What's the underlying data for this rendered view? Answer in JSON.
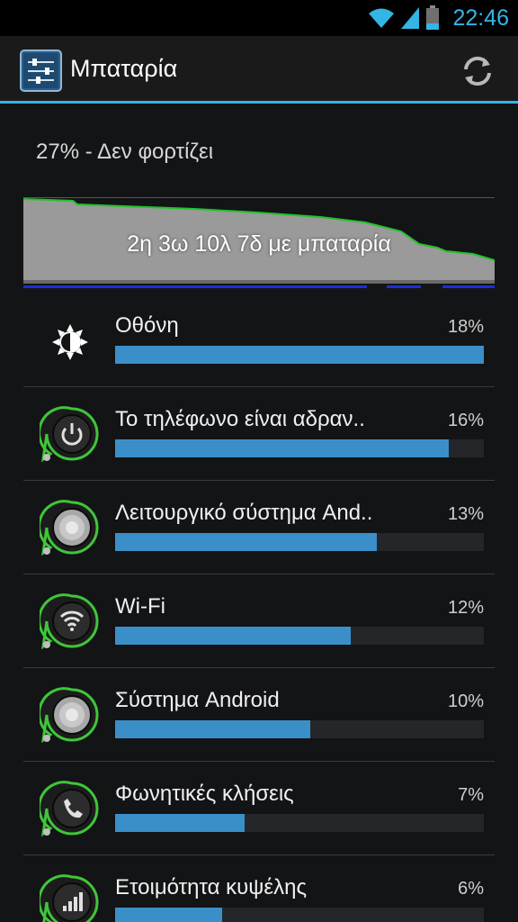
{
  "status_bar": {
    "time": "22:46"
  },
  "action_bar": {
    "title": "Μπαταρία"
  },
  "battery_status": "27% - Δεν φορτίζει",
  "graph_label": "2η 3ω 10λ 7δ με μπαταρία",
  "usage": [
    {
      "label": "Οθόνη",
      "percent": "18%",
      "fraction": 1.0,
      "icon": "brightness-icon"
    },
    {
      "label": "Το τηλέφωνο είναι αδραν..",
      "percent": "16%",
      "fraction": 0.905,
      "icon": "power-icon"
    },
    {
      "label": "Λειτουργικό σύστημα And..",
      "percent": "13%",
      "fraction": 0.71,
      "icon": "android-os-icon"
    },
    {
      "label": "Wi-Fi",
      "percent": "12%",
      "fraction": 0.64,
      "icon": "wifi-icon"
    },
    {
      "label": "Σύστημα Android",
      "percent": "10%",
      "fraction": 0.53,
      "icon": "android-system-icon"
    },
    {
      "label": "Φωνητικές κλήσεις",
      "percent": "7%",
      "fraction": 0.35,
      "icon": "phone-call-icon"
    },
    {
      "label": "Ετοιμότητα κυψέλης",
      "percent": "6%",
      "fraction": 0.29,
      "icon": "cell-signal-icon"
    }
  ],
  "colors": {
    "accent": "#33b5e5",
    "bar": "#3b8fc9",
    "graph_line": "#22c22a"
  }
}
